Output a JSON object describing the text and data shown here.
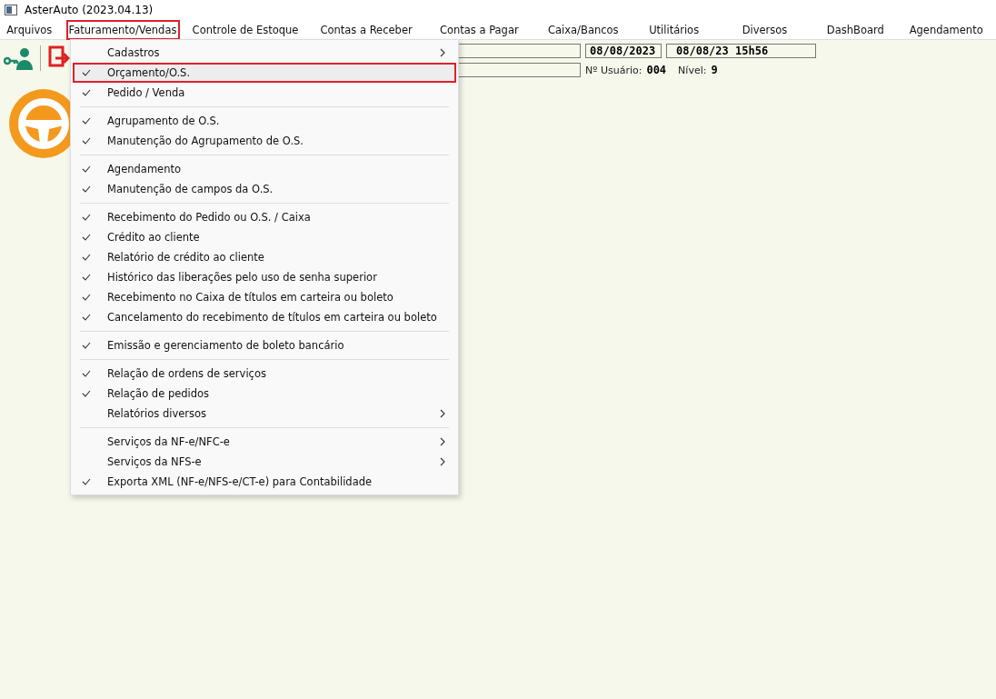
{
  "window": {
    "title": "AsterAuto (2023.04.13)"
  },
  "menubar": [
    {
      "label": "Arquivos",
      "selected": false
    },
    {
      "label": "Faturamento/Vendas",
      "selected": true
    },
    {
      "label": "Controle de Estoque",
      "selected": false
    },
    {
      "label": "Contas a Receber",
      "selected": false
    },
    {
      "label": "Contas a Pagar",
      "selected": false
    },
    {
      "label": "Caixa/Bancos",
      "selected": false
    },
    {
      "label": "Utilitários",
      "selected": false
    },
    {
      "label": "Diversos",
      "selected": false
    },
    {
      "label": "DashBoard",
      "selected": false
    },
    {
      "label": "Agendamento",
      "selected": false
    }
  ],
  "status": {
    "date": "08/08/2023",
    "datetime": "08/08/23 15h56",
    "user_label": "Nº Usuário:",
    "user": "004",
    "level_label": "Nível:",
    "level_value": "9"
  },
  "menu": {
    "groups": [
      {
        "items": [
          {
            "label": "Cadastros",
            "checked": false,
            "submenu": true,
            "selected": false
          },
          {
            "label": "Orçamento/O.S.",
            "checked": true,
            "submenu": false,
            "selected": true
          },
          {
            "label": "Pedido / Venda",
            "checked": true,
            "submenu": false,
            "selected": false
          }
        ]
      },
      {
        "items": [
          {
            "label": "Agrupamento de O.S.",
            "checked": true,
            "submenu": false,
            "selected": false
          },
          {
            "label": "Manutenção do Agrupamento de O.S.",
            "checked": true,
            "submenu": false,
            "selected": false
          }
        ]
      },
      {
        "items": [
          {
            "label": "Agendamento",
            "checked": true,
            "submenu": false,
            "selected": false
          },
          {
            "label": "Manutenção de campos da O.S.",
            "checked": true,
            "submenu": false,
            "selected": false
          }
        ]
      },
      {
        "items": [
          {
            "label": "Recebimento do Pedido ou O.S. / Caixa",
            "checked": true,
            "submenu": false,
            "selected": false
          },
          {
            "label": "Crédito ao cliente",
            "checked": true,
            "submenu": false,
            "selected": false
          },
          {
            "label": "Relatório de crédito ao cliente",
            "checked": true,
            "submenu": false,
            "selected": false
          },
          {
            "label": "Histórico das liberações pelo uso de senha superior",
            "checked": true,
            "submenu": false,
            "selected": false
          },
          {
            "label": "Recebimento no Caixa de títulos em carteira ou boleto",
            "checked": true,
            "submenu": false,
            "selected": false
          },
          {
            "label": "Cancelamento do recebimento de títulos em carteira ou boleto",
            "checked": true,
            "submenu": false,
            "selected": false
          }
        ]
      },
      {
        "items": [
          {
            "label": "Emissão e gerenciamento de boleto bancário",
            "checked": true,
            "submenu": false,
            "selected": false
          }
        ]
      },
      {
        "items": [
          {
            "label": "Relação de ordens de serviços",
            "checked": true,
            "submenu": false,
            "selected": false
          },
          {
            "label": "Relação de pedidos",
            "checked": true,
            "submenu": false,
            "selected": false
          },
          {
            "label": "Relatórios diversos",
            "checked": false,
            "submenu": true,
            "selected": false
          }
        ]
      },
      {
        "items": [
          {
            "label": "Serviços da NF-e/NFC-e",
            "checked": false,
            "submenu": true,
            "selected": false
          },
          {
            "label": "Serviços da NFS-e",
            "checked": false,
            "submenu": true,
            "selected": false
          },
          {
            "label": "Exporta XML (NF-e/NFS-e/CT-e) para Contabilidade",
            "checked": true,
            "submenu": false,
            "selected": false
          }
        ]
      }
    ]
  }
}
